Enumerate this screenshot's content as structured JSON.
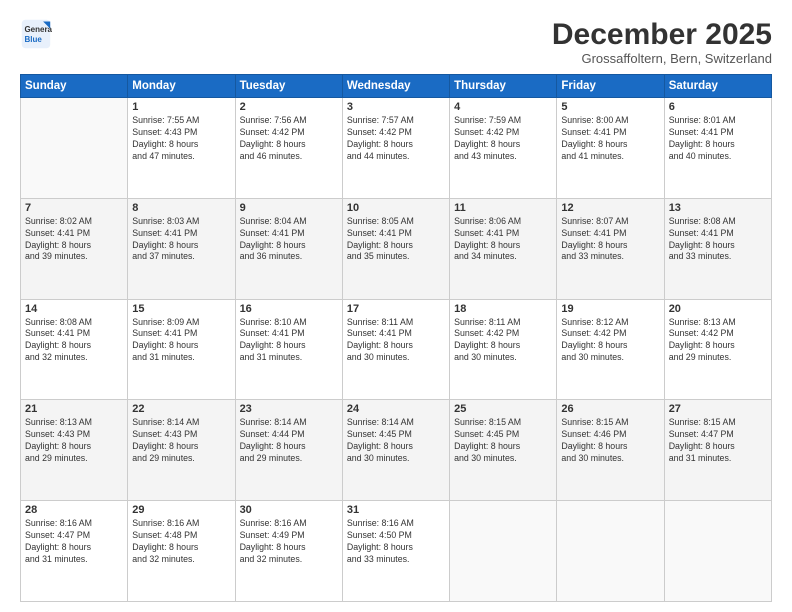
{
  "header": {
    "logo_line1": "General",
    "logo_line2": "Blue",
    "month": "December 2025",
    "location": "Grossaffoltern, Bern, Switzerland"
  },
  "weekdays": [
    "Sunday",
    "Monday",
    "Tuesday",
    "Wednesday",
    "Thursday",
    "Friday",
    "Saturday"
  ],
  "weeks": [
    [
      {
        "day": "",
        "info": ""
      },
      {
        "day": "1",
        "info": "Sunrise: 7:55 AM\nSunset: 4:43 PM\nDaylight: 8 hours\nand 47 minutes."
      },
      {
        "day": "2",
        "info": "Sunrise: 7:56 AM\nSunset: 4:42 PM\nDaylight: 8 hours\nand 46 minutes."
      },
      {
        "day": "3",
        "info": "Sunrise: 7:57 AM\nSunset: 4:42 PM\nDaylight: 8 hours\nand 44 minutes."
      },
      {
        "day": "4",
        "info": "Sunrise: 7:59 AM\nSunset: 4:42 PM\nDaylight: 8 hours\nand 43 minutes."
      },
      {
        "day": "5",
        "info": "Sunrise: 8:00 AM\nSunset: 4:41 PM\nDaylight: 8 hours\nand 41 minutes."
      },
      {
        "day": "6",
        "info": "Sunrise: 8:01 AM\nSunset: 4:41 PM\nDaylight: 8 hours\nand 40 minutes."
      }
    ],
    [
      {
        "day": "7",
        "info": "Sunrise: 8:02 AM\nSunset: 4:41 PM\nDaylight: 8 hours\nand 39 minutes."
      },
      {
        "day": "8",
        "info": "Sunrise: 8:03 AM\nSunset: 4:41 PM\nDaylight: 8 hours\nand 37 minutes."
      },
      {
        "day": "9",
        "info": "Sunrise: 8:04 AM\nSunset: 4:41 PM\nDaylight: 8 hours\nand 36 minutes."
      },
      {
        "day": "10",
        "info": "Sunrise: 8:05 AM\nSunset: 4:41 PM\nDaylight: 8 hours\nand 35 minutes."
      },
      {
        "day": "11",
        "info": "Sunrise: 8:06 AM\nSunset: 4:41 PM\nDaylight: 8 hours\nand 34 minutes."
      },
      {
        "day": "12",
        "info": "Sunrise: 8:07 AM\nSunset: 4:41 PM\nDaylight: 8 hours\nand 33 minutes."
      },
      {
        "day": "13",
        "info": "Sunrise: 8:08 AM\nSunset: 4:41 PM\nDaylight: 8 hours\nand 33 minutes."
      }
    ],
    [
      {
        "day": "14",
        "info": "Sunrise: 8:08 AM\nSunset: 4:41 PM\nDaylight: 8 hours\nand 32 minutes."
      },
      {
        "day": "15",
        "info": "Sunrise: 8:09 AM\nSunset: 4:41 PM\nDaylight: 8 hours\nand 31 minutes."
      },
      {
        "day": "16",
        "info": "Sunrise: 8:10 AM\nSunset: 4:41 PM\nDaylight: 8 hours\nand 31 minutes."
      },
      {
        "day": "17",
        "info": "Sunrise: 8:11 AM\nSunset: 4:41 PM\nDaylight: 8 hours\nand 30 minutes."
      },
      {
        "day": "18",
        "info": "Sunrise: 8:11 AM\nSunset: 4:42 PM\nDaylight: 8 hours\nand 30 minutes."
      },
      {
        "day": "19",
        "info": "Sunrise: 8:12 AM\nSunset: 4:42 PM\nDaylight: 8 hours\nand 30 minutes."
      },
      {
        "day": "20",
        "info": "Sunrise: 8:13 AM\nSunset: 4:42 PM\nDaylight: 8 hours\nand 29 minutes."
      }
    ],
    [
      {
        "day": "21",
        "info": "Sunrise: 8:13 AM\nSunset: 4:43 PM\nDaylight: 8 hours\nand 29 minutes."
      },
      {
        "day": "22",
        "info": "Sunrise: 8:14 AM\nSunset: 4:43 PM\nDaylight: 8 hours\nand 29 minutes."
      },
      {
        "day": "23",
        "info": "Sunrise: 8:14 AM\nSunset: 4:44 PM\nDaylight: 8 hours\nand 29 minutes."
      },
      {
        "day": "24",
        "info": "Sunrise: 8:14 AM\nSunset: 4:45 PM\nDaylight: 8 hours\nand 30 minutes."
      },
      {
        "day": "25",
        "info": "Sunrise: 8:15 AM\nSunset: 4:45 PM\nDaylight: 8 hours\nand 30 minutes."
      },
      {
        "day": "26",
        "info": "Sunrise: 8:15 AM\nSunset: 4:46 PM\nDaylight: 8 hours\nand 30 minutes."
      },
      {
        "day": "27",
        "info": "Sunrise: 8:15 AM\nSunset: 4:47 PM\nDaylight: 8 hours\nand 31 minutes."
      }
    ],
    [
      {
        "day": "28",
        "info": "Sunrise: 8:16 AM\nSunset: 4:47 PM\nDaylight: 8 hours\nand 31 minutes."
      },
      {
        "day": "29",
        "info": "Sunrise: 8:16 AM\nSunset: 4:48 PM\nDaylight: 8 hours\nand 32 minutes."
      },
      {
        "day": "30",
        "info": "Sunrise: 8:16 AM\nSunset: 4:49 PM\nDaylight: 8 hours\nand 32 minutes."
      },
      {
        "day": "31",
        "info": "Sunrise: 8:16 AM\nSunset: 4:50 PM\nDaylight: 8 hours\nand 33 minutes."
      },
      {
        "day": "",
        "info": ""
      },
      {
        "day": "",
        "info": ""
      },
      {
        "day": "",
        "info": ""
      }
    ]
  ]
}
